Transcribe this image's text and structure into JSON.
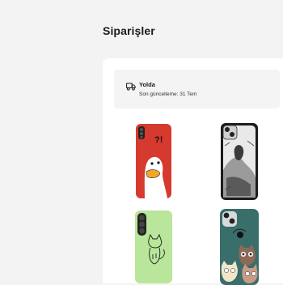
{
  "page": {
    "title": "Siparişler"
  },
  "order": {
    "status_label": "Yolda",
    "update_text": "Son güncelleme: 31 Tem",
    "status_icon": "truck-icon"
  },
  "products": [
    {
      "name": "duck-phone-case-image",
      "color": "#d63a2f"
    },
    {
      "name": "sketch-girl-phone-case-image",
      "color": "#1c1c1c"
    },
    {
      "name": "cat-lineart-phone-case-image",
      "color": "#b9e69a"
    },
    {
      "name": "cats-phone-case-image",
      "color": "#3a6e6a"
    }
  ]
}
